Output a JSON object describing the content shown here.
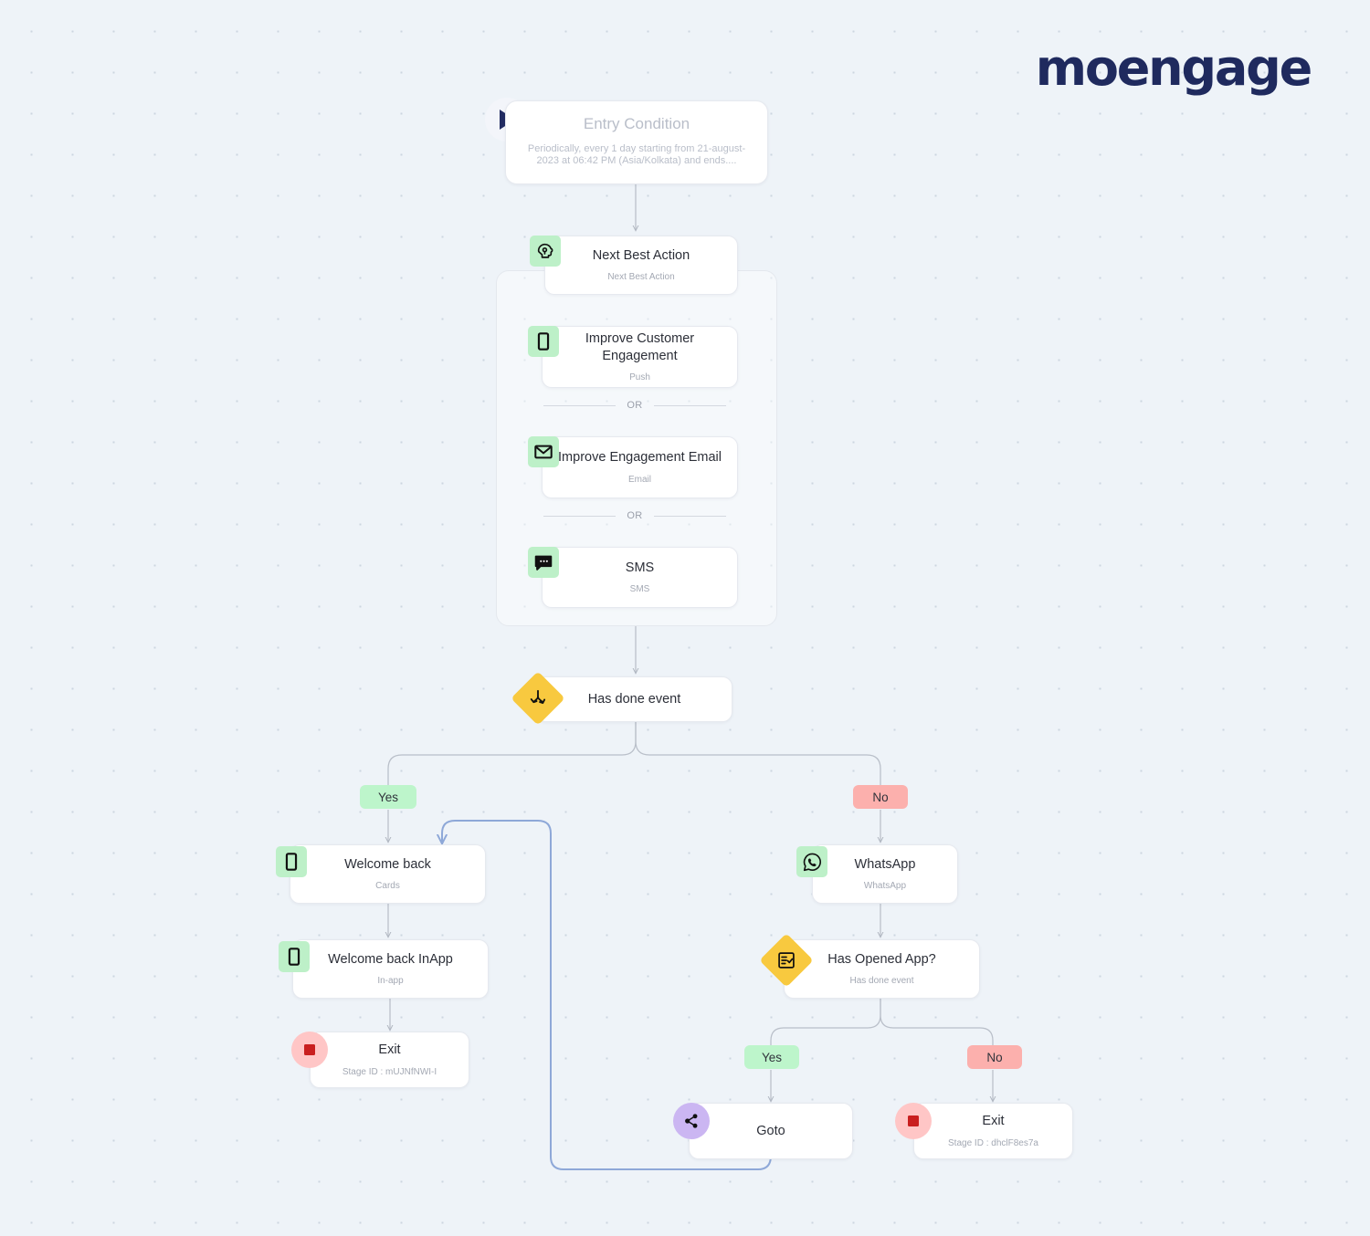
{
  "brand": {
    "logo_text": "moengage",
    "logo_color": "#1f2a5e"
  },
  "colors": {
    "canvas_bg": "#eef3f8",
    "dot": "#ccd6e0",
    "icon_green": "#bdf0c8",
    "diamond_yellow": "#f8c93f",
    "exit_red": "#ffc6c6",
    "goto_purple": "#cbb6f2",
    "pill_yes": "#bdf5cb",
    "pill_no": "#fcb0ad",
    "edge_grey": "#b9bfc9",
    "edge_blue": "#8ea8d8"
  },
  "flow": {
    "entry": {
      "title": "Entry Condition",
      "description": "Periodically, every 1 day starting from 21-august-2023 at 06:42 PM (Asia/Kolkata) and ends....",
      "icon": "play-icon"
    },
    "next_best_action": {
      "title": "Next Best Action",
      "subtitle": "Next Best Action",
      "icon": "brain-head-icon"
    },
    "nba_children": [
      {
        "title": "Improve Customer Engagement",
        "subtitle": "Push",
        "icon": "mobile-push-icon"
      },
      {
        "title": "Improve Engagement Email",
        "subtitle": "Email",
        "icon": "envelope-icon"
      },
      {
        "title": "SMS",
        "subtitle": "SMS",
        "icon": "sms-bubble-icon"
      }
    ],
    "or_labels": [
      "OR",
      "OR"
    ],
    "condition_main": {
      "title": "Has done event",
      "subtitle": "",
      "icon": "branch-split-icon"
    },
    "branch_labels": {
      "yes": "Yes",
      "no": "No"
    },
    "yes_branch": [
      {
        "title": "Welcome back",
        "subtitle": "Cards",
        "icon": "mobile-cards-icon"
      },
      {
        "title": "Welcome back InApp",
        "subtitle": "In-app",
        "icon": "mobile-inapp-icon"
      },
      {
        "title": "Exit",
        "subtitle": "Stage ID : mUJNfNWI-I",
        "icon": "exit-stop-icon"
      }
    ],
    "no_branch": {
      "whatsapp": {
        "title": "WhatsApp",
        "subtitle": "WhatsApp",
        "icon": "whatsapp-icon"
      },
      "condition": {
        "title": "Has Opened App?",
        "subtitle": "Has done event",
        "icon": "checklist-icon"
      },
      "sub_labels": {
        "yes": "Yes",
        "no": "No"
      },
      "goto": {
        "title": "Goto",
        "subtitle": "",
        "icon": "share-goto-icon"
      },
      "exit": {
        "title": "Exit",
        "subtitle": "Stage ID : dhclF8es7a",
        "icon": "exit-stop-icon"
      }
    }
  }
}
